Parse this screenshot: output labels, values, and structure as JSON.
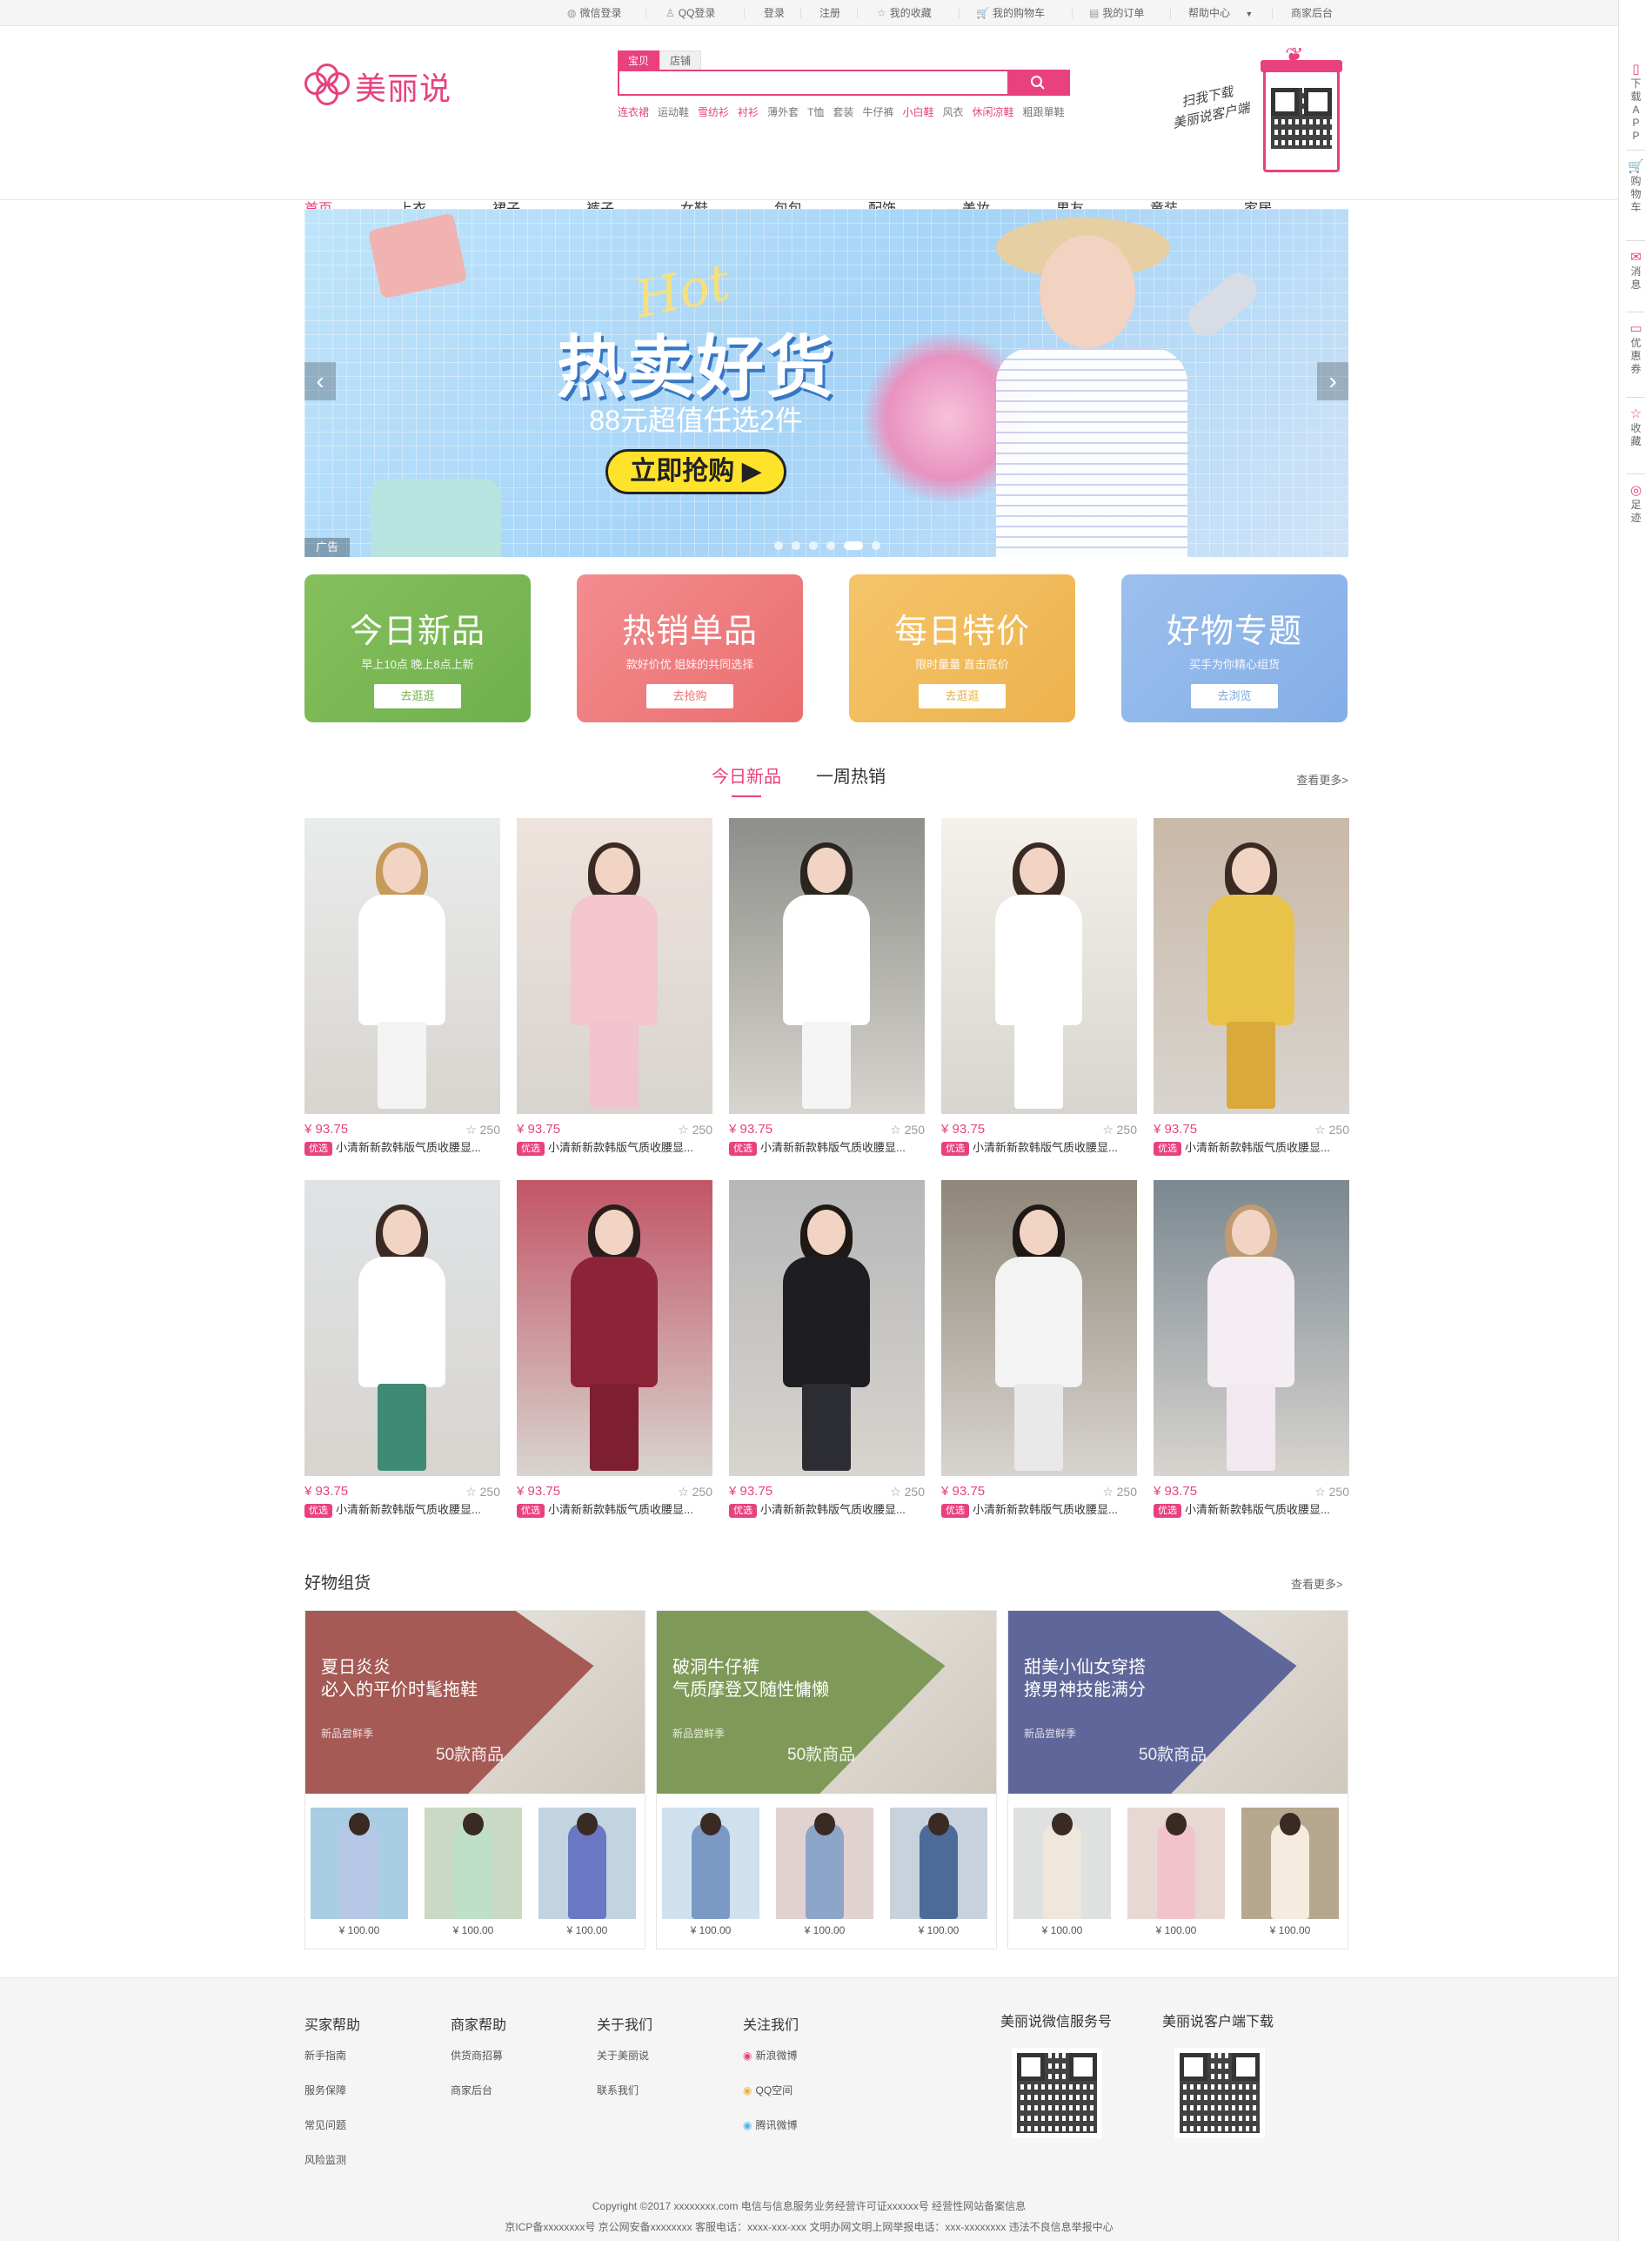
{
  "topbar": {
    "items": [
      "微信登录",
      "QQ登录",
      "登录",
      "注册",
      "我的收藏",
      "我的购物车",
      "我的订单",
      "帮助中心",
      "商家后台"
    ]
  },
  "header": {
    "logo_text": "美丽说",
    "search": {
      "tabs": [
        "宝贝",
        "店铺"
      ],
      "active_tab": "宝贝",
      "value": "",
      "placeholder": ""
    },
    "hot_words": [
      {
        "text": "连衣裙",
        "hl": true
      },
      {
        "text": "运动鞋",
        "hl": false
      },
      {
        "text": "雪纺衫",
        "hl": true
      },
      {
        "text": "衬衫",
        "hl": true
      },
      {
        "text": "薄外套",
        "hl": false
      },
      {
        "text": "T恤",
        "hl": false
      },
      {
        "text": "套装",
        "hl": false
      },
      {
        "text": "牛仔裤",
        "hl": false
      },
      {
        "text": "小白鞋",
        "hl": true
      },
      {
        "text": "风衣",
        "hl": false
      },
      {
        "text": "休闲凉鞋",
        "hl": true
      },
      {
        "text": "粗跟單鞋",
        "hl": false
      }
    ],
    "promo_text": [
      "扫我下载",
      "美丽说客户端"
    ]
  },
  "nav": [
    "首页",
    "上衣",
    "裙子",
    "裤子",
    "女鞋",
    "包包",
    "配饰",
    "美妆",
    "男友",
    "童装",
    "家居"
  ],
  "banner": {
    "hot": "Hot",
    "title": "热卖好货",
    "subtitle": "88元超值任选2件",
    "cta": "立即抢购 ▶",
    "ad_label": "广告",
    "slide_count": 6,
    "active_slide": 5
  },
  "tiles": [
    {
      "title": "今日新品",
      "sub": "早上10点 晚上8点上新",
      "btn": "去逛逛",
      "color": "#85c05d",
      "color2": "#6fb04c",
      "btn_color": "#73b24f"
    },
    {
      "title": "热销单品",
      "sub": "款好价优 姐妹的共同选择",
      "btn": "去抢购",
      "color": "#f38d8f",
      "color2": "#ea6d6f",
      "btn_color": "#eb7071"
    },
    {
      "title": "每日特价",
      "sub": "限时量量 直击底价",
      "btn": "去逛逛",
      "color": "#f5c56a",
      "color2": "#ecb24d",
      "btn_color": "#e9af44"
    },
    {
      "title": "好物专题",
      "sub": "买手为你精心组货",
      "btn": "去浏览",
      "color": "#9cc0ee",
      "color2": "#83aee6",
      "btn_color": "#7aa6e0"
    }
  ],
  "section_tabs": {
    "items": [
      "今日新品",
      "一周热销"
    ],
    "active": 0,
    "more": "查看更多>"
  },
  "products": [
    {
      "price": "¥ 93.75",
      "likes": "☆ 250",
      "tag": "优选",
      "name": "小清新新款韩版气质收腰显..."
    },
    {
      "price": "¥ 93.75",
      "likes": "☆ 250",
      "tag": "优选",
      "name": "小清新新款韩版气质收腰显..."
    },
    {
      "price": "¥ 93.75",
      "likes": "☆ 250",
      "tag": "优选",
      "name": "小清新新款韩版气质收腰显..."
    },
    {
      "price": "¥ 93.75",
      "likes": "☆ 250",
      "tag": "优选",
      "name": "小清新新款韩版气质收腰显..."
    },
    {
      "price": "¥ 93.75",
      "likes": "☆ 250",
      "tag": "优选",
      "name": "小清新新款韩版气质收腰显..."
    },
    {
      "price": "¥ 93.75",
      "likes": "☆ 250",
      "tag": "优选",
      "name": "小清新新款韩版气质收腰显..."
    },
    {
      "price": "¥ 93.75",
      "likes": "☆ 250",
      "tag": "优选",
      "name": "小清新新款韩版气质收腰显..."
    },
    {
      "price": "¥ 93.75",
      "likes": "☆ 250",
      "tag": "优选",
      "name": "小清新新款韩版气质收腰显..."
    },
    {
      "price": "¥ 93.75",
      "likes": "☆ 250",
      "tag": "优选",
      "name": "小清新新款韩版气质收腰显..."
    },
    {
      "price": "¥ 93.75",
      "likes": "☆ 250",
      "tag": "优选",
      "name": "小清新新款韩版气质收腰显..."
    }
  ],
  "groups_section": {
    "title": "好物组货",
    "more": "查看更多>"
  },
  "groups": [
    {
      "line1": "夏日炎炎",
      "line2": "必入的平价时髦拖鞋",
      "season": "新品尝鲜季",
      "count": "50款商品",
      "color": "#a55a55",
      "thumb_price": [
        "¥ 100.00",
        "¥ 100.00",
        "¥ 100.00"
      ]
    },
    {
      "line1": "破洞牛仔裤",
      "line2": "气质摩登又随性慵懒",
      "season": "新品尝鲜季",
      "count": "50款商品",
      "color": "#7f9a58",
      "thumb_price": [
        "¥ 100.00",
        "¥ 100.00",
        "¥ 100.00"
      ]
    },
    {
      "line1": "甜美小仙女穿搭",
      "line2": "撩男神技能满分",
      "season": "新品尝鲜季",
      "count": "50款商品",
      "color": "#5f6699",
      "thumb_price": [
        "¥ 100.00",
        "¥ 100.00",
        "¥ 100.00"
      ]
    }
  ],
  "footer": {
    "cols": [
      {
        "title": "买家帮助",
        "items": [
          "新手指南",
          "服务保障",
          "常见问题",
          "风险监测"
        ]
      },
      {
        "title": "商家帮助",
        "items": [
          "供货商招募",
          "商家后台"
        ]
      },
      {
        "title": "关于我们",
        "items": [
          "关于美丽说",
          "联系我们"
        ]
      },
      {
        "title": "关注我们",
        "items": [
          "新浪微博",
          "QQ空间",
          "腾讯微博"
        ]
      }
    ],
    "qr1": "美丽说微信服务号",
    "qr2": "美丽说客户端下载",
    "copy1": "Copyright ©2017 xxxxxxxx.com 电信与信息服务业务经营许可证xxxxxx号 经营性网站备案信息",
    "copy2": "京ICP备xxxxxxxx号 京公网安备xxxxxxxx 客服电话：xxxx-xxx-xxx 文明办网文明上网举报电话：xxx-xxxxxxxx 违法不良信息举报中心"
  },
  "sidebar": [
    {
      "icon": "▯",
      "label": "下载APP"
    },
    {
      "icon": "🛒",
      "label": "购物车"
    },
    {
      "icon": "✉",
      "label": "消息"
    },
    {
      "icon": "▭",
      "label": "优惠券"
    },
    {
      "icon": "☆",
      "label": "收藏"
    },
    {
      "icon": "◎",
      "label": "足迹"
    }
  ],
  "colors": {
    "accent": "#e8417e"
  }
}
